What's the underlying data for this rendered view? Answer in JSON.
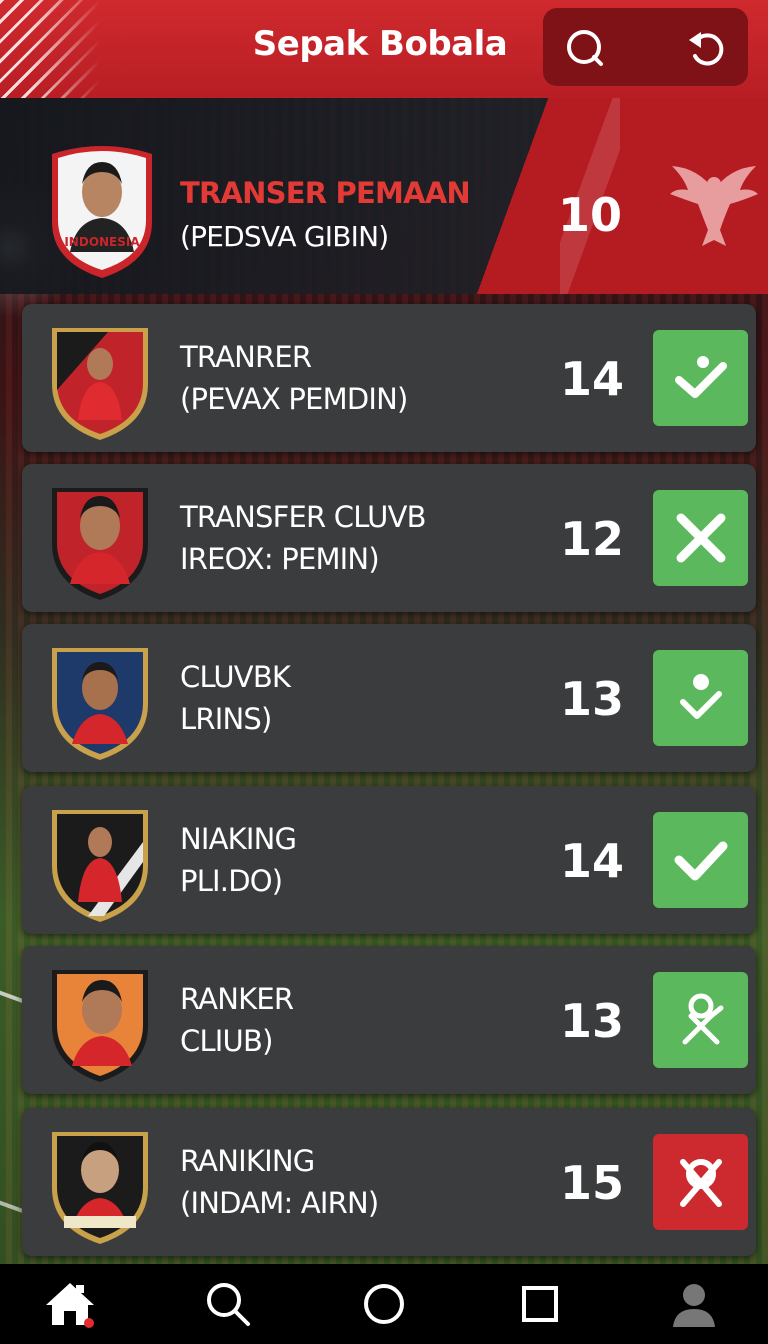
{
  "app": {
    "title": "Sepak Bobala"
  },
  "colors": {
    "brand_red": "#cf2a2e",
    "accept_green": "#5cb85c",
    "reject_red": "#cc2a2e",
    "card": "#3b3c3d"
  },
  "featured": {
    "title": "TRANSER PEMAAN",
    "subtitle": "(PEDSVA GIBIN)",
    "number": "10",
    "badge_text": "INDONESIA"
  },
  "items": [
    {
      "title": "TRANRER",
      "subtitle": "(PEVAX PEMDIN)",
      "number": "14",
      "action": "check-icon",
      "action_color": "green"
    },
    {
      "title": "TRANSFER CLUVB",
      "subtitle": "IREOX: PEMIN)",
      "number": "12",
      "action": "close-icon",
      "action_color": "green"
    },
    {
      "title": "CLUVBK",
      "subtitle": "LRINS)",
      "number": "13",
      "action": "person-check-icon",
      "action_color": "green"
    },
    {
      "title": "NIAKING",
      "subtitle": "PLI.DO)",
      "number": "14",
      "action": "check-icon",
      "action_color": "green"
    },
    {
      "title": "RANKER",
      "subtitle": "CLIUB)",
      "number": "13",
      "action": "person-cross-icon",
      "action_color": "green"
    },
    {
      "title": "RANIKING",
      "subtitle": "(INDAM: AIRN)",
      "number": "15",
      "action": "person-cross-icon",
      "action_color": "red"
    }
  ],
  "nav": {
    "items": [
      "home-icon",
      "search-icon",
      "circle-icon",
      "square-icon",
      "profile-icon"
    ]
  }
}
